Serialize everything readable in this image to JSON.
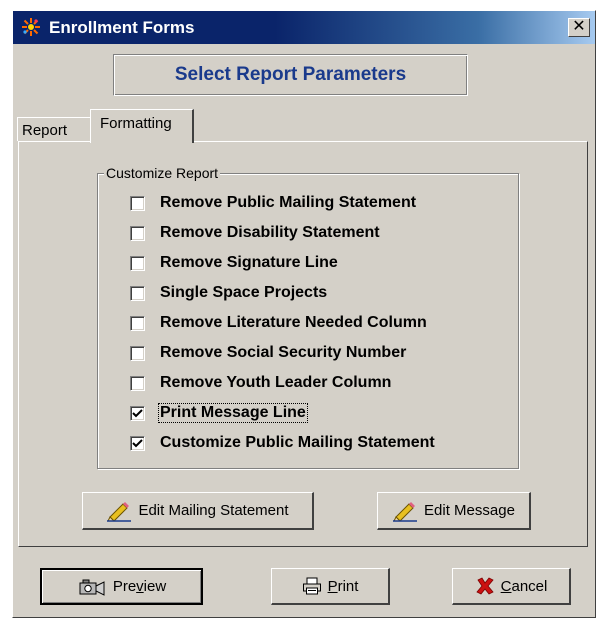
{
  "window": {
    "title": "Enrollment Forms",
    "close_symbol": "✕",
    "icon": "sparkle-app-icon"
  },
  "header": {
    "title": "Select Report Parameters"
  },
  "tabs": [
    {
      "label": "Report",
      "active": false
    },
    {
      "label": "Formatting",
      "active": true
    }
  ],
  "group": {
    "legend": "Customize Report",
    "options": [
      {
        "label": "Remove Public Mailing Statement",
        "checked": false
      },
      {
        "label": "Remove Disability Statement",
        "checked": false
      },
      {
        "label": "Remove Signature Line",
        "checked": false
      },
      {
        "label": "Single Space Projects",
        "checked": false
      },
      {
        "label": "Remove Literature Needed Column",
        "checked": false
      },
      {
        "label": "Remove Social Security Number",
        "checked": false
      },
      {
        "label": "Remove Youth Leader Column",
        "checked": false
      },
      {
        "label": "Print Message Line",
        "checked": true
      },
      {
        "label": "Customize Public Mailing Statement",
        "checked": true
      }
    ]
  },
  "edit_buttons": {
    "mailing": {
      "label": "Edit Mailing Statement",
      "icon": "pencil-icon"
    },
    "message": {
      "label": "Edit Message",
      "icon": "pencil-icon"
    }
  },
  "footer": {
    "preview": {
      "pre": "Pre",
      "accel": "v",
      "post": "iew",
      "icon": "preview-camera-icon"
    },
    "print": {
      "pre": "",
      "accel": "P",
      "post": "rint",
      "icon": "printer-icon"
    },
    "cancel": {
      "pre": "",
      "accel": "C",
      "post": "ancel",
      "icon": "red-x-icon"
    }
  },
  "colors": {
    "accent_text": "#1a3a8c",
    "cancel_icon": "#cc1111",
    "titlebar": "#0a246a"
  }
}
